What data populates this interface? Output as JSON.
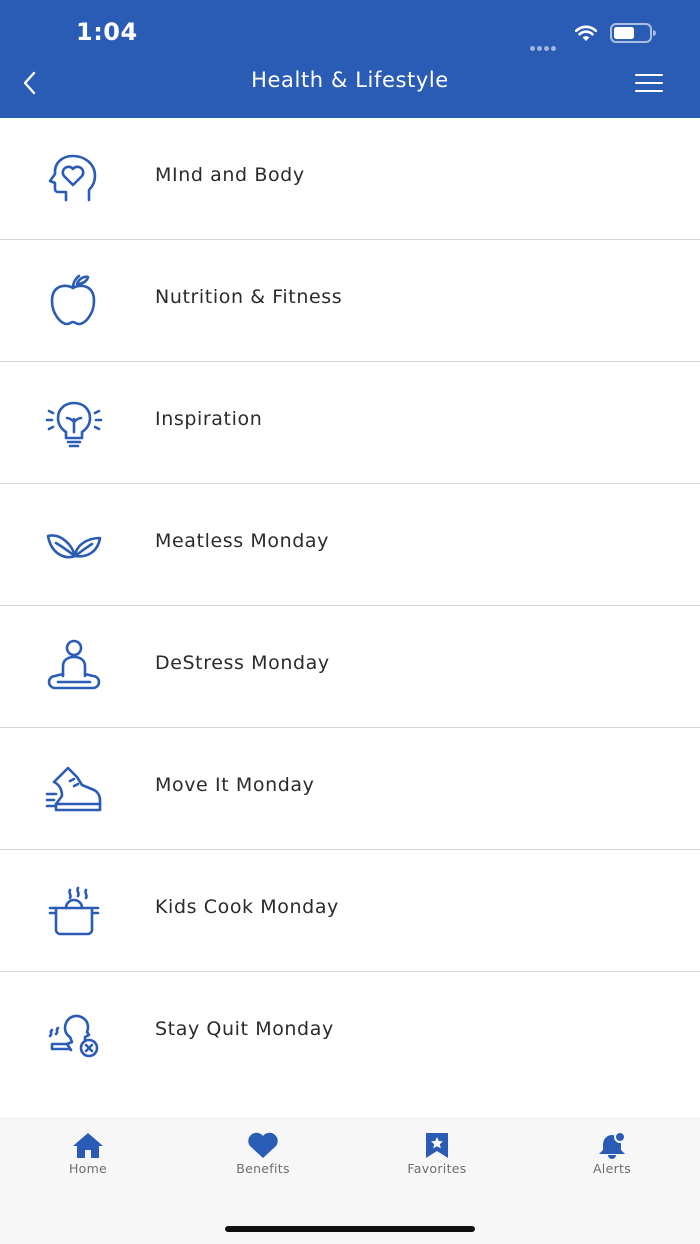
{
  "status_bar": {
    "time": "1:04"
  },
  "header": {
    "title": "Health & Lifestyle"
  },
  "list": [
    {
      "label": "MInd and Body",
      "icon": "head-heart-icon"
    },
    {
      "label": "Nutrition & Fitness",
      "icon": "apple-icon"
    },
    {
      "label": "Inspiration",
      "icon": "lightbulb-icon"
    },
    {
      "label": "Meatless Monday",
      "icon": "leaves-icon"
    },
    {
      "label": "DeStress Monday",
      "icon": "meditation-icon"
    },
    {
      "label": "Move It Monday",
      "icon": "running-shoe-icon"
    },
    {
      "label": "Kids Cook Monday",
      "icon": "cooking-pot-icon"
    },
    {
      "label": "Stay Quit Monday",
      "icon": "no-smoking-icon"
    }
  ],
  "tabbar": {
    "home": "Home",
    "benefits": "Benefits",
    "favorites": "Favorites",
    "alerts": "Alerts"
  },
  "colors": {
    "brand": "#2a5cb5",
    "icon": "#2a5cb5",
    "divider": "#d6d6d6",
    "tab_label": "#6d6d6d"
  }
}
